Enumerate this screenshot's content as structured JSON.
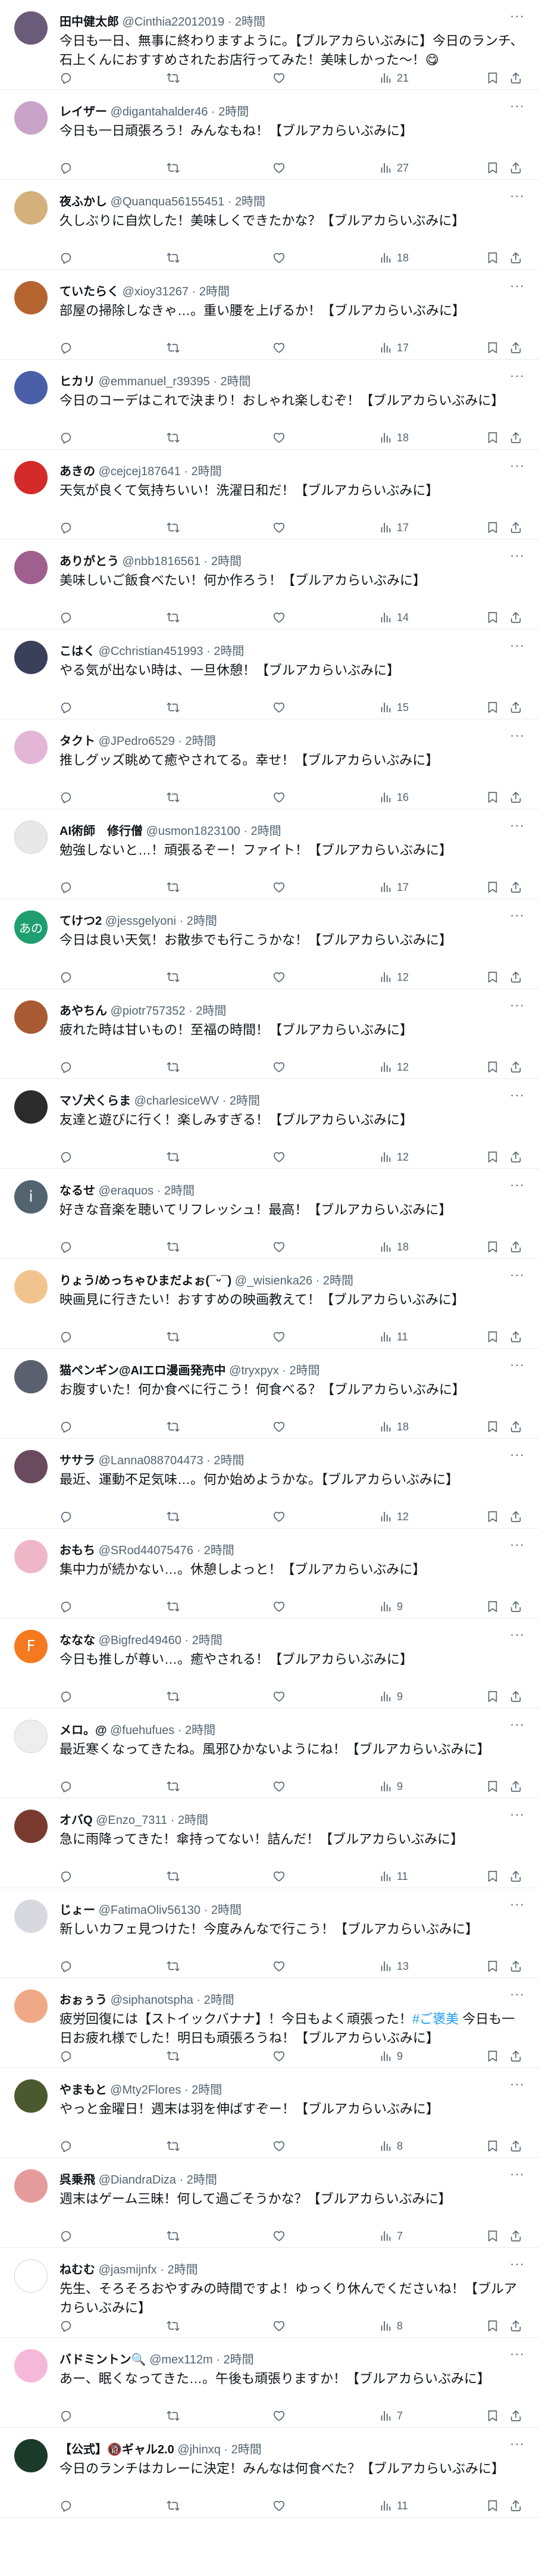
{
  "colors": {
    "text": "#0f1419",
    "secondary": "#536471",
    "accent": "#1d9bf0",
    "divider": "#e6ecf0"
  },
  "posts": [
    {
      "name": "田中健太郎",
      "handle": "@Cinthia22012019",
      "time": "2時間",
      "text": "今日も一日、無事に終わりますように。【ブルアカらいぶみに】今日のランチ、石上くんにおすすめされたお店行ってみた！美味しかった〜！😋",
      "views": "21",
      "avatar_color": "#6b5b7a",
      "avatar_letter": ""
    },
    {
      "name": "レイザー",
      "handle": "@digantahalder46",
      "time": "2時間",
      "text": "今日も一日頑張ろう！みんなもね！【ブルアカらいぶみに】",
      "views": "27",
      "avatar_color": "#c9a3c8",
      "avatar_letter": ""
    },
    {
      "name": "夜ふかし",
      "handle": "@Quanqua56155451",
      "time": "2時間",
      "text": "久しぶりに自炊した！美味しくできたかな？【ブルアカらいぶみに】",
      "views": "18",
      "avatar_color": "#d4b07a",
      "avatar_letter": ""
    },
    {
      "name": "ていたらく",
      "handle": "@xioy31267",
      "time": "2時間",
      "text": "部屋の掃除しなきゃ…。重い腰を上げるか！【ブルアカらいぶみに】",
      "views": "17",
      "avatar_color": "#b5642f",
      "avatar_letter": ""
    },
    {
      "name": "ヒカリ",
      "handle": "@emmanuel_r39395",
      "time": "2時間",
      "text": "今日のコーデはこれで決まり！おしゃれ楽しむぞ！【ブルアカらいぶみに】",
      "views": "18",
      "avatar_color": "#4a5fa8",
      "avatar_letter": ""
    },
    {
      "name": "あきの",
      "handle": "@cejcej187641",
      "time": "2時間",
      "text": "天気が良くて気持ちいい！洗濯日和だ！【ブルアカらいぶみに】",
      "views": "17",
      "avatar_color": "#d42a2a",
      "avatar_letter": ""
    },
    {
      "name": "ありがとう",
      "handle": "@nbb1816561",
      "time": "2時間",
      "text": "美味しいご飯食べたい！何か作ろう！【ブルアカらいぶみに】",
      "views": "14",
      "avatar_color": "#a0608f",
      "avatar_letter": ""
    },
    {
      "name": "こはく",
      "handle": "@Cchristian451993",
      "time": "2時間",
      "text": "やる気が出ない時は、一旦休憩！【ブルアカらいぶみに】",
      "views": "15",
      "avatar_color": "#3a3f5a",
      "avatar_letter": ""
    },
    {
      "name": "タクト",
      "handle": "@JPedro6529",
      "time": "2時間",
      "text": "推しグッズ眺めて癒やされてる。幸せ！【ブルアカらいぶみに】",
      "views": "16",
      "avatar_color": "#e3b6d8",
      "avatar_letter": ""
    },
    {
      "name": "AI術師　修行僧",
      "handle": "@usmon1823100",
      "time": "2時間",
      "text": "勉強しないと…！頑張るぞー！ファイト！【ブルアカらいぶみに】",
      "views": "17",
      "avatar_color": "#e8e8e8",
      "avatar_letter": ""
    },
    {
      "name": "てけつ2",
      "handle": "@jessgelyoni",
      "time": "2時間",
      "text": "今日は良い天気！お散歩でも行こうかな！【ブルアカらいぶみに】",
      "views": "12",
      "avatar_color": "#1f9e6f",
      "avatar_letter": "あの"
    },
    {
      "name": "あやちん",
      "handle": "@piotr757352",
      "time": "2時間",
      "text": "疲れた時は甘いもの！至福の時間！【ブルアカらいぶみに】",
      "views": "12",
      "avatar_color": "#a85a32",
      "avatar_letter": ""
    },
    {
      "name": "マゾ犬くらま",
      "handle": "@charlesiceWV",
      "time": "2時間",
      "text": "友達と遊びに行く！楽しみすぎる！【ブルアカらいぶみに】",
      "views": "12",
      "avatar_color": "#2b2b2b",
      "avatar_letter": ""
    },
    {
      "name": "なるせ",
      "handle": "@eraquos",
      "time": "2時間",
      "text": "好きな音楽を聴いてリフレッシュ！最高！【ブルアカらいぶみに】",
      "views": "18",
      "avatar_color": "#536471",
      "avatar_letter": "i"
    },
    {
      "name": "りょう/めっちゃひまだよぉ(¯ᵕ¯)",
      "handle": "@_wisienka26",
      "time": "2時間",
      "text": "映画見に行きたい！おすすめの映画教えて！【ブルアカらいぶみに】",
      "views": "11",
      "avatar_color": "#f2c48d",
      "avatar_letter": ""
    },
    {
      "name": "猫ペンギン@AIエロ漫画発売中",
      "handle": "@tryxpyx",
      "time": "2時間",
      "text": "お腹すいた！何か食べに行こう！何食べる？【ブルアカらいぶみに】",
      "views": "18",
      "avatar_color": "#5b6070",
      "avatar_letter": ""
    },
    {
      "name": "ササラ",
      "handle": "@Lanna088704473",
      "time": "2時間",
      "text": "最近、運動不足気味…。何か始めようかな。【ブルアカらいぶみに】",
      "views": "12",
      "avatar_color": "#6a4a5e",
      "avatar_letter": ""
    },
    {
      "name": "おもち",
      "handle": "@SRod44075476",
      "time": "2時間",
      "text": "集中力が続かない…。休憩しよっと！【ブルアカらいぶみに】",
      "views": "9",
      "avatar_color": "#f0b7c9",
      "avatar_letter": ""
    },
    {
      "name": "ななな",
      "handle": "@Bigfred49460",
      "time": "2時間",
      "text": "今日も推しが尊い…。癒やされる！【ブルアカらいぶみに】",
      "views": "9",
      "avatar_color": "#f4791f",
      "avatar_letter": "F"
    },
    {
      "name": "メロ。@",
      "handle": "@fuehufues",
      "time": "2時間",
      "text": "最近寒くなってきたね。風邪ひかないようにね！【ブルアカらいぶみに】",
      "views": "9",
      "avatar_color": "#eeeeee",
      "avatar_letter": ""
    },
    {
      "name": "オバQ",
      "handle": "@Enzo_7311",
      "time": "2時間",
      "text": "急に雨降ってきた！傘持ってない！詰んだ！【ブルアカらいぶみに】",
      "views": "11",
      "avatar_color": "#7a3b2e",
      "avatar_letter": ""
    },
    {
      "name": "じょー",
      "handle": "@FatimaOliv56130",
      "time": "2時間",
      "text": "新しいカフェ見つけた！今度みんなで行こう！【ブルアカらいぶみに】",
      "views": "13",
      "avatar_color": "#d8d8e0",
      "avatar_letter": ""
    },
    {
      "name": "おぉぅう",
      "handle": "@siphanotspha",
      "time": "2時間",
      "text_parts": [
        "疲労回復には【ストイックバナナ】！今日もよく頑張った！",
        "#ご褒美",
        " 今日も一日お疲れ様でした！明日も頑張ろうね！【ブルアカらいぶみに】"
      ],
      "views": "9",
      "avatar_color": "#f0a986",
      "avatar_letter": ""
    },
    {
      "name": "やまもと",
      "handle": "@Mty2Flores",
      "time": "2時間",
      "text": "やっと金曜日！週末は羽を伸ばすぞー！【ブルアカらいぶみに】",
      "views": "8",
      "avatar_color": "#4a5a2e",
      "avatar_letter": ""
    },
    {
      "name": "呉乗飛",
      "handle": "@DiandraDiza",
      "time": "2時間",
      "text": "週末はゲーム三昧！何して過ごそうかな？【ブルアカらいぶみに】",
      "views": "7",
      "avatar_color": "#e59b9b",
      "avatar_letter": ""
    },
    {
      "name": "ねむむ",
      "handle": "@jasmijnfx",
      "time": "2時間",
      "text": "先生、そろそろおやすみの時間ですよ！ゆっくり休んでくださいね！【ブルアカらいぶみに】",
      "views": "8",
      "avatar_color": "#ffffff",
      "avatar_letter": ""
    },
    {
      "name": "バドミントン🔍",
      "handle": "@mex112m",
      "time": "2時間",
      "text": "あー、眠くなってきた…。午後も頑張りますか！【ブルアカらいぶみに】",
      "views": "7",
      "avatar_color": "#f5b8d8",
      "avatar_letter": ""
    },
    {
      "name": "【公式】🔞ギャル2.0",
      "handle": "@jhinxq",
      "time": "2時間",
      "text": "今日のランチはカレーに決定！みんなは何食べた？【ブルアカらいぶみに】",
      "views": "11",
      "avatar_color": "#1a3a2a",
      "avatar_letter": ""
    }
  ]
}
